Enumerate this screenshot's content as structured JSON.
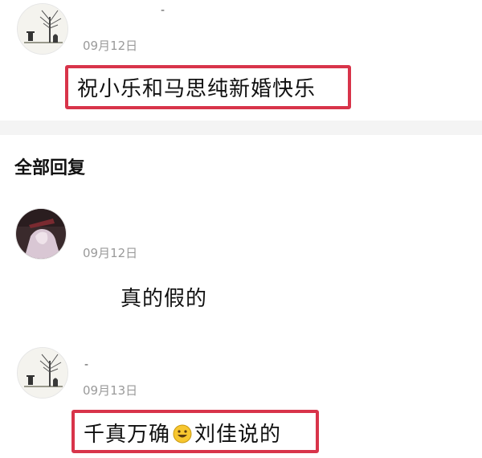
{
  "comments": [
    {
      "username": "-",
      "date": "09月12日",
      "text": "祝小乐和马思纯新婚快乐",
      "avatar_icon": "tree-avatar-icon",
      "highlighted": true
    },
    {
      "username": "",
      "date": "09月12日",
      "text": "真的假的",
      "avatar_icon": "photo-avatar-icon",
      "highlighted": false
    },
    {
      "username": "-",
      "date": "09月13日",
      "text_before": "千真万确",
      "emoji_icon": "smiley-face-icon",
      "text_after": "刘佳说的",
      "avatar_icon": "tree-avatar-icon",
      "highlighted": true
    }
  ],
  "section": {
    "title": "全部回复"
  },
  "colors": {
    "highlight_border": "#d8344a",
    "date_text": "#9a9a9a",
    "divider": "#f4f4f4"
  }
}
